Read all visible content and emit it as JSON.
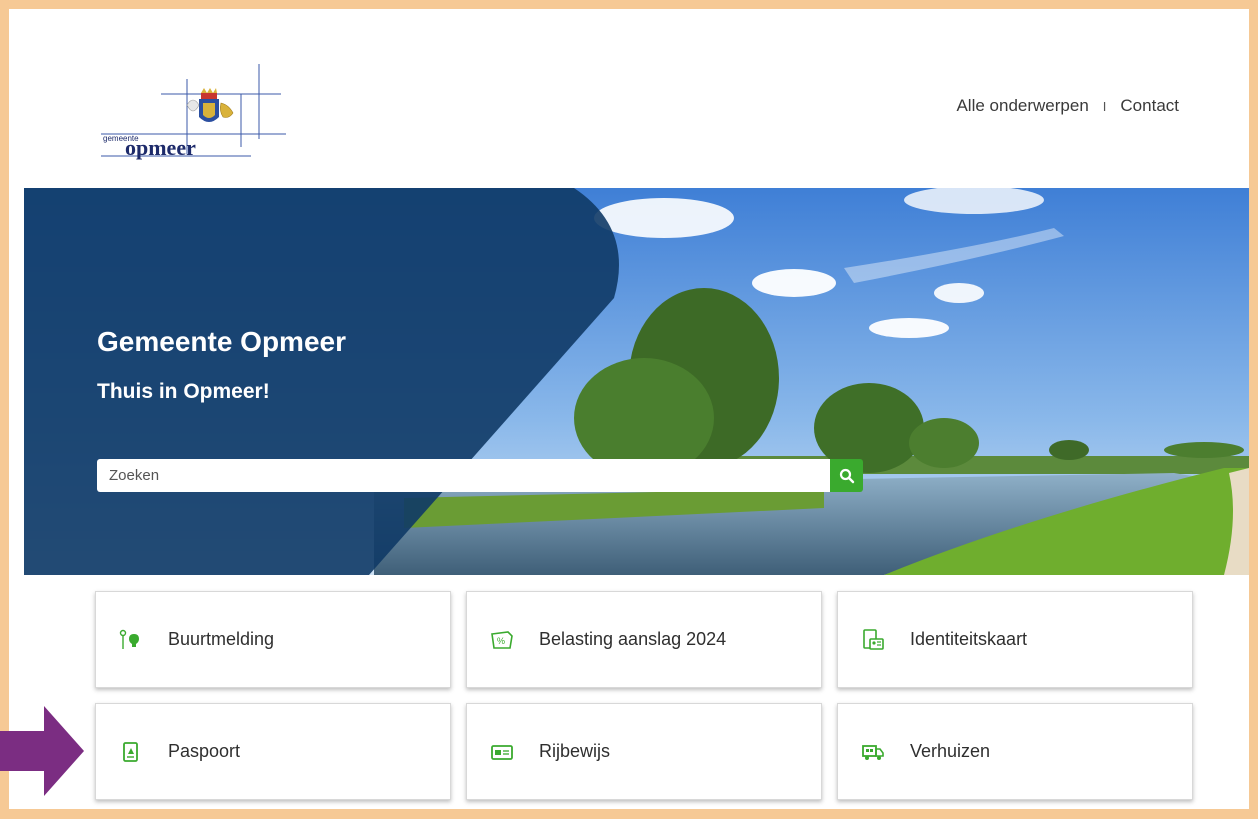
{
  "header": {
    "logo_text_small": "gemeente",
    "logo_text_large": "opmeer",
    "nav": [
      {
        "label": "Alle onderwerpen"
      },
      {
        "label": "Contact"
      }
    ],
    "nav_separator": "I"
  },
  "hero": {
    "title": "Gemeente Opmeer",
    "subtitle": "Thuis in Opmeer!",
    "search": {
      "placeholder": "Zoeken",
      "value": ""
    }
  },
  "tiles": [
    {
      "label": "Buurtmelding",
      "icon": "streetlight-icon"
    },
    {
      "label": "Belasting aanslag 2024",
      "icon": "tax-notice-icon"
    },
    {
      "label": "Identiteitskaart",
      "icon": "id-card-icon"
    },
    {
      "label": "Paspoort",
      "icon": "passport-icon"
    },
    {
      "label": "Rijbewijs",
      "icon": "drivers-license-icon"
    },
    {
      "label": "Verhuizen",
      "icon": "moving-truck-icon"
    }
  ],
  "colors": {
    "border": "#f6c995",
    "hero_overlay": "#0f3a66",
    "accent_green": "#3aaa2e",
    "annotation_arrow": "#7b2d82"
  }
}
